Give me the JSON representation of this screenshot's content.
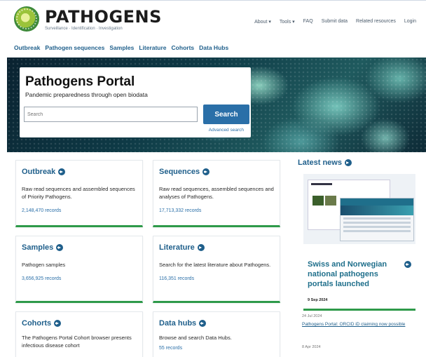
{
  "brand": {
    "title": "PATHOGENS",
    "subtitle": "Surveillance · Identification · Investigation"
  },
  "topnav": [
    "About ▾",
    "Tools ▾",
    "FAQ",
    "Submit data",
    "Related resources",
    "Login"
  ],
  "subnav": [
    "Outbreak",
    "Pathogen sequences",
    "Samples",
    "Literature",
    "Cohorts",
    "Data Hubs"
  ],
  "hero": {
    "title": "Pathogens Portal",
    "subtitle": "Pandemic preparedness through open biodata",
    "search_placeholder": "Search",
    "search_button": "Search",
    "advanced_search": "Advanced search"
  },
  "cards": [
    {
      "title": "Outbreak",
      "desc": "Raw read sequences and assembled sequences of Priority Pathogens.",
      "count": "2,148,470 records"
    },
    {
      "title": "Sequences",
      "desc": "Raw read sequences, assembled sequences and analyses of Pathogens.",
      "count": "17,713,332 records"
    },
    {
      "title": "Samples",
      "desc": "Pathogen samples",
      "count": "3,656,925 records"
    },
    {
      "title": "Literature",
      "desc": "Search for the latest literature about Pathogens.",
      "count": "116,351 records"
    },
    {
      "title": "Cohorts",
      "desc": "The Pathogens Portal Cohort browser presents infectious disease cohort",
      "count": ""
    },
    {
      "title": "Data hubs",
      "desc": "Browse and search Data Hubs.",
      "count": "55 records"
    }
  ],
  "news": {
    "title": "Latest news",
    "feature_headline": "Swiss and Norwegian national pathogens portals launched",
    "feature_date": "9 Sep 2024",
    "items": [
      {
        "date": "24 Jul 2024",
        "link": "Pathogens Portal: ORCID iD claiming now possible"
      },
      {
        "date": "8 Apr 2024",
        "link": ""
      }
    ]
  }
}
